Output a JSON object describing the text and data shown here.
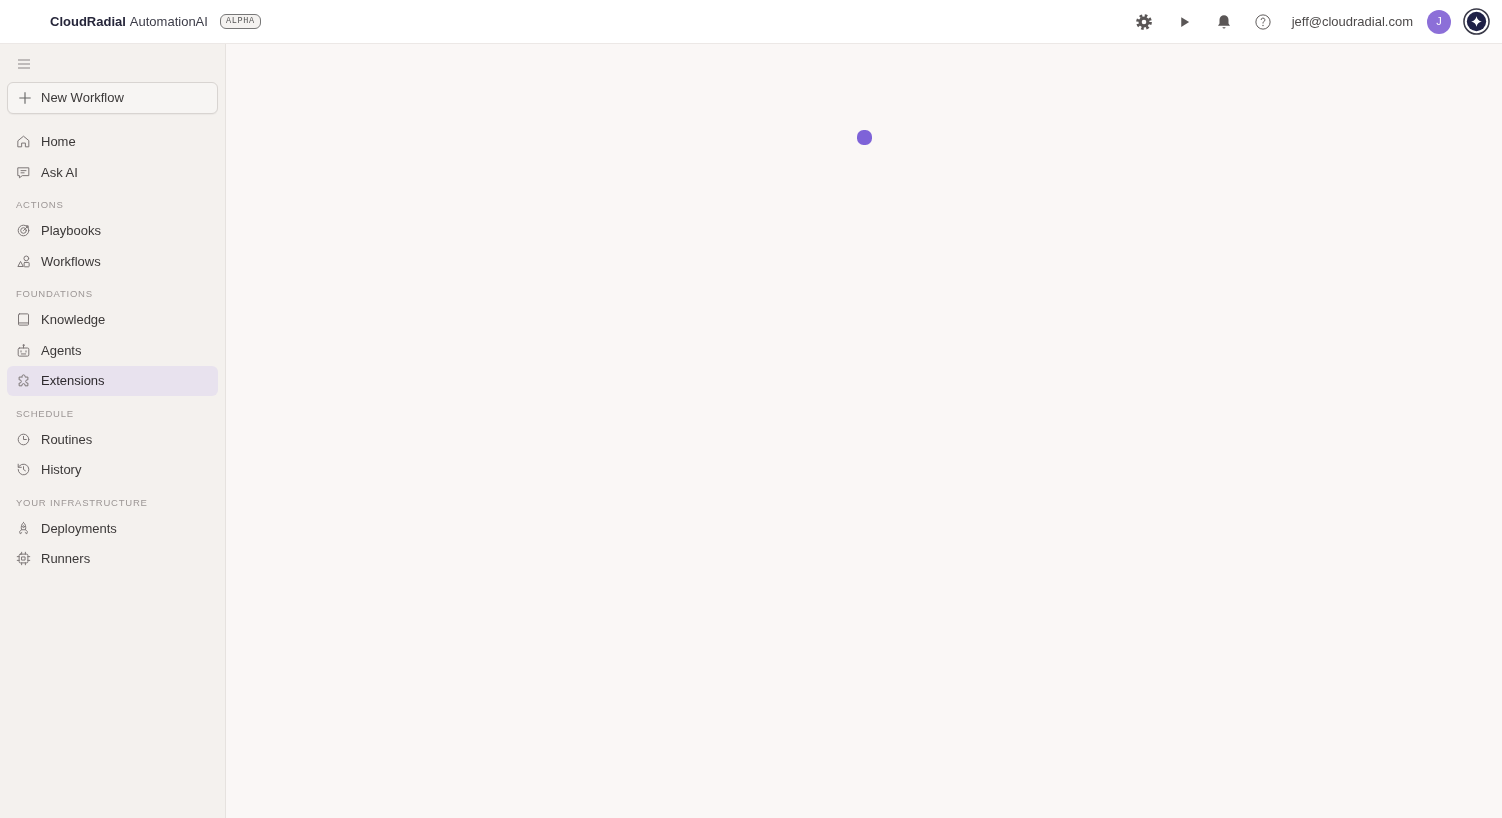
{
  "header": {
    "brand": "CloudRadial",
    "product": "AutomationAI",
    "badge": "ALPHA",
    "user_email": "jeff@cloudradial.com",
    "avatar_initial": "J"
  },
  "sidebar": {
    "new_button": "New Workflow",
    "sections": [
      {
        "items": [
          {
            "label": "Home",
            "selected": false
          },
          {
            "label": "Ask AI",
            "selected": false
          }
        ]
      },
      {
        "title": "ACTIONS",
        "items": [
          {
            "label": "Playbooks",
            "selected": false
          },
          {
            "label": "Workflows",
            "selected": false
          }
        ]
      },
      {
        "title": "FOUNDATIONS",
        "items": [
          {
            "label": "Knowledge",
            "selected": false
          },
          {
            "label": "Agents",
            "selected": false
          },
          {
            "label": "Extensions",
            "selected": true
          }
        ]
      },
      {
        "title": "SCHEDULE",
        "items": [
          {
            "label": "Routines",
            "selected": false
          },
          {
            "label": "History",
            "selected": false
          }
        ]
      },
      {
        "title": "YOUR INFRASTRUCTURE",
        "items": [
          {
            "label": "Deployments",
            "selected": false
          },
          {
            "label": "Runners",
            "selected": false
          }
        ]
      }
    ]
  }
}
